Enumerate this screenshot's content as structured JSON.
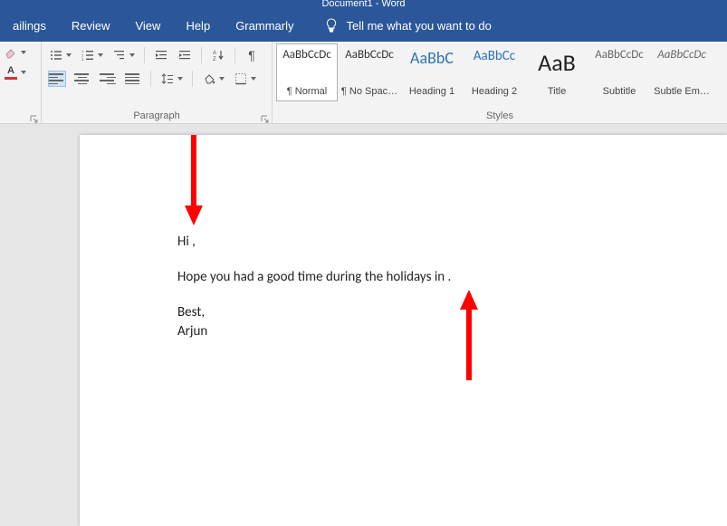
{
  "title_bar": "Document1 - Word",
  "tabs": {
    "mailings": "ailings",
    "review": "Review",
    "view": "View",
    "help": "Help",
    "grammarly": "Grammarly"
  },
  "tellme": {
    "placeholder": "Tell me what you want to do"
  },
  "paragraph": {
    "label": "Paragraph"
  },
  "styles": {
    "label": "Styles",
    "items": [
      {
        "preview": "AaBbCcDc",
        "name": "¶ Normal",
        "color": "#333",
        "size": "13px",
        "selected": true
      },
      {
        "preview": "AaBbCcDc",
        "name": "¶ No Spac…",
        "color": "#333",
        "size": "13px",
        "selected": false
      },
      {
        "preview": "AaBbC",
        "name": "Heading 1",
        "color": "#2e74b5",
        "size": "18px",
        "selected": false
      },
      {
        "preview": "AaBbCc",
        "name": "Heading 2",
        "color": "#2e74b5",
        "size": "15px",
        "selected": false
      },
      {
        "preview": "AaB",
        "name": "Title",
        "color": "#222",
        "size": "26px",
        "selected": false
      },
      {
        "preview": "AaBbCcDc",
        "name": "Subtitle",
        "color": "#666",
        "size": "13px",
        "selected": false
      },
      {
        "preview": "AaBbCcDc",
        "name": "Subtle Em…",
        "color": "#666",
        "size": "13px",
        "selected": false,
        "italic": true
      }
    ]
  },
  "document": {
    "greeting": "Hi ,",
    "body": "Hope you had a good time during the holidays in .",
    "closing": "Best,",
    "signature": "Arjun"
  }
}
